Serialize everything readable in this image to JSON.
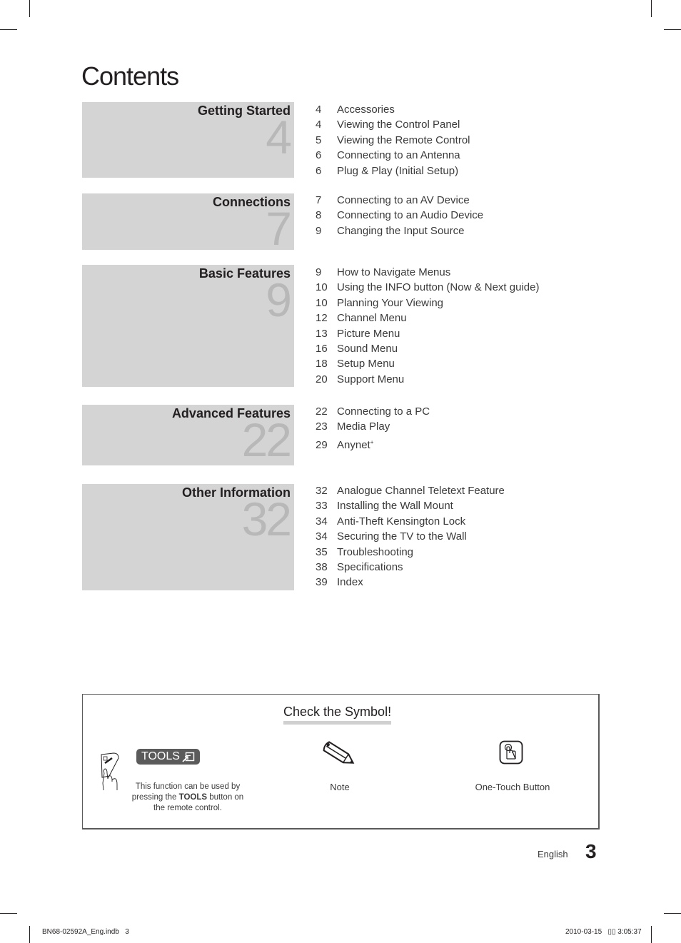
{
  "page": {
    "title": "Contents",
    "language": "English",
    "page_number": "3"
  },
  "chapters": [
    {
      "title": "Getting Started",
      "start_page": "4",
      "entries": [
        {
          "page": "4",
          "label": "Accessories"
        },
        {
          "page": "4",
          "label": "Viewing the Control Panel"
        },
        {
          "page": "5",
          "label": "Viewing the Remote Control"
        },
        {
          "page": "6",
          "label": "Connecting to an Antenna"
        },
        {
          "page": "6",
          "label": "Plug & Play (Initial Setup)"
        }
      ]
    },
    {
      "title": "Connections",
      "start_page": "7",
      "entries": [
        {
          "page": "7",
          "label": "Connecting to an AV Device"
        },
        {
          "page": "8",
          "label": "Connecting to an Audio Device"
        },
        {
          "page": "9",
          "label": "Changing the Input Source"
        }
      ]
    },
    {
      "title": "Basic Features",
      "start_page": "9",
      "entries": [
        {
          "page": "9",
          "label": "How to Navigate Menus"
        },
        {
          "page": "10",
          "label": "Using the INFO button (Now & Next guide)"
        },
        {
          "page": "10",
          "label": "Planning Your Viewing"
        },
        {
          "page": "12",
          "label": "Channel Menu"
        },
        {
          "page": "13",
          "label": "Picture Menu"
        },
        {
          "page": "16",
          "label": "Sound Menu"
        },
        {
          "page": "18",
          "label": "Setup Menu"
        },
        {
          "page": "20",
          "label": "Support Menu"
        }
      ]
    },
    {
      "title": "Advanced Features",
      "start_page": "22",
      "entries": [
        {
          "page": "22",
          "label": "Connecting to a PC"
        },
        {
          "page": "23",
          "label": "Media Play"
        },
        {
          "page": "29",
          "label": "Anynet",
          "superscript": "+"
        }
      ]
    },
    {
      "title": "Other Information",
      "start_page": "32",
      "entries": [
        {
          "page": "32",
          "label": "Analogue Channel Teletext Feature"
        },
        {
          "page": "33",
          "label": "Installing the Wall Mount"
        },
        {
          "page": "34",
          "label": "Anti-Theft Kensington Lock"
        },
        {
          "page": "34",
          "label": "Securing the TV to the Wall"
        },
        {
          "page": "35",
          "label": "Troubleshooting"
        },
        {
          "page": "38",
          "label": "Specifications"
        },
        {
          "page": "39",
          "label": "Index"
        }
      ]
    }
  ],
  "symbols": {
    "title": "Check the Symbol!",
    "tools": {
      "badge_label": "TOOLS",
      "icon": "tools-arrow-icon",
      "desc_pre": "This function can be used by pressing the ",
      "desc_bold": "TOOLS",
      "desc_post": " button on the remote control."
    },
    "note": {
      "label": "Note",
      "icon": "pencil-icon"
    },
    "one_touch": {
      "label": "One-Touch Button",
      "icon": "finger-press-icon"
    }
  },
  "slug": {
    "file": "BN68-02592A_Eng.indb   3",
    "timestamp": "2010-03-15   ▯▯ 3:05:37"
  },
  "colors": {
    "chapter_bg": "#d4d4d4",
    "chapter_number": "#b8b8b8",
    "text": "#231f20",
    "tools_badge": "#5b5b5b"
  }
}
